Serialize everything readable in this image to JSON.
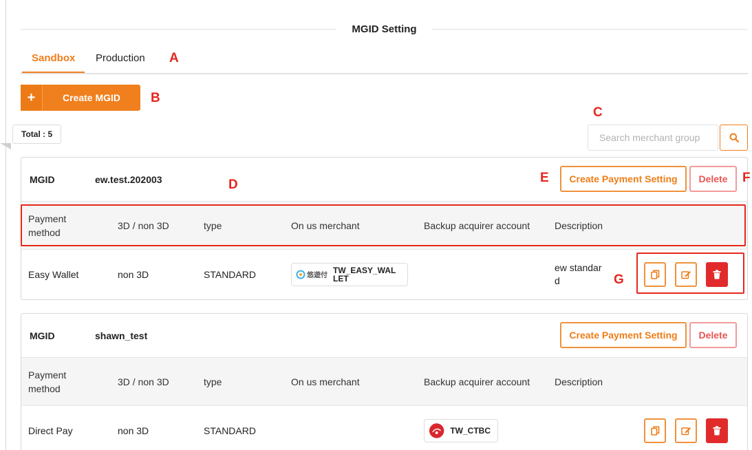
{
  "page": {
    "section_title": "MGID Setting",
    "tabs": [
      "Sandbox",
      "Production"
    ],
    "create_button": "Create MGID",
    "total_label": "Total : 5",
    "search_placeholder": "Search merchant group"
  },
  "annotations": {
    "A": "A",
    "B": "B",
    "C": "C",
    "D": "D",
    "E": "E",
    "F": "F",
    "G": "G"
  },
  "table_headers": [
    "Payment method",
    "3D / non 3D",
    "type",
    "On us merchant",
    "Backup acquirer account",
    "Description"
  ],
  "cards": [
    {
      "mgid_label": "MGID",
      "mgid_value": "ew.test.202003",
      "create_payment_label": "Create Payment Setting",
      "delete_label": "Delete",
      "row": {
        "payment_method": "Easy Wallet",
        "three_d": "non 3D",
        "type": "STANDARD",
        "on_us_logo_text": "悠遊付",
        "on_us_merchant": "TW_EASY_WALLET",
        "backup_acquirer": "",
        "description": "ew standard"
      }
    },
    {
      "mgid_label": "MGID",
      "mgid_value": "shawn_test",
      "create_payment_label": "Create Payment Setting",
      "delete_label": "Delete",
      "row": {
        "payment_method": "Direct Pay",
        "three_d": "non 3D",
        "type": "STANDARD",
        "on_us_merchant": "",
        "backup_acquirer": "TW_CTBC",
        "description": ""
      }
    }
  ],
  "icons": {
    "plus": "plus-icon",
    "search": "search-icon",
    "copy": "copy-icon",
    "edit": "edit-icon",
    "trash": "trash-icon"
  },
  "colors": {
    "accent": "#f07f1d",
    "danger": "#e12b2b",
    "annotation": "#e8261c"
  }
}
